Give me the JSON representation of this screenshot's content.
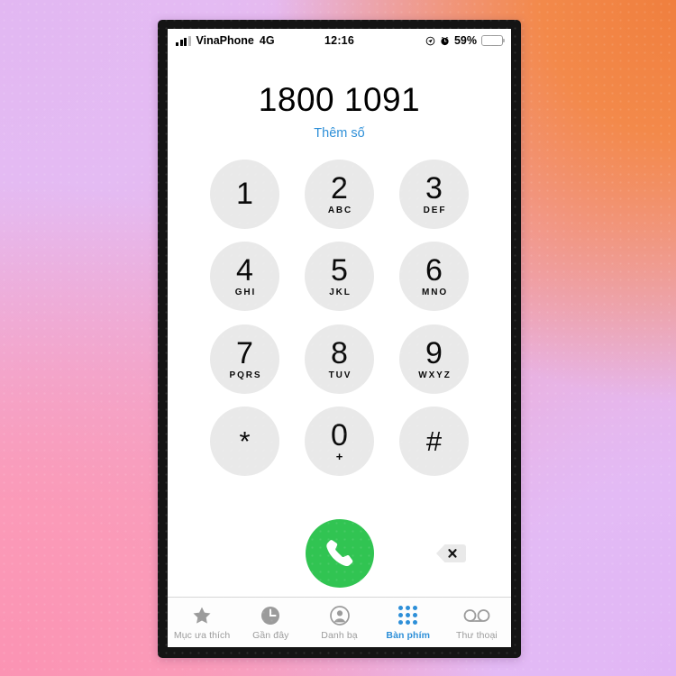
{
  "status_bar": {
    "carrier": "VinaPhone",
    "network": "4G",
    "time": "12:16",
    "battery_percent": "59%",
    "battery_level": 59,
    "icons": [
      "signal-bars-icon",
      "location-icon",
      "alarm-icon",
      "battery-icon"
    ]
  },
  "display": {
    "phone_number": "1800 1091",
    "add_number_label": "Thêm số"
  },
  "keypad": {
    "rows": [
      [
        {
          "digit": "1",
          "letters": ""
        },
        {
          "digit": "2",
          "letters": "ABC"
        },
        {
          "digit": "3",
          "letters": "DEF"
        }
      ],
      [
        {
          "digit": "4",
          "letters": "GHI"
        },
        {
          "digit": "5",
          "letters": "JKL"
        },
        {
          "digit": "6",
          "letters": "MNO"
        }
      ],
      [
        {
          "digit": "7",
          "letters": "PQRS"
        },
        {
          "digit": "8",
          "letters": "TUV"
        },
        {
          "digit": "9",
          "letters": "WXYZ"
        }
      ],
      [
        {
          "digit": "*",
          "letters": ""
        },
        {
          "digit": "0",
          "letters": "+"
        },
        {
          "digit": "#",
          "letters": ""
        }
      ]
    ]
  },
  "actions": {
    "call_icon": "phone-handset-icon",
    "delete_icon": "backspace-icon"
  },
  "tab_bar": {
    "active_index": 3,
    "tabs": [
      {
        "label": "Mục ưa thích",
        "icon": "star-icon"
      },
      {
        "label": "Gần đây",
        "icon": "clock-icon"
      },
      {
        "label": "Danh bạ",
        "icon": "person-circle-icon"
      },
      {
        "label": "Bàn phím",
        "icon": "keypad-dots-icon"
      },
      {
        "label": "Thư thoại",
        "icon": "voicemail-icon"
      }
    ]
  },
  "colors": {
    "accent_blue": "#2d8fd8",
    "call_green": "#31c452",
    "key_grey": "#e9e9e9",
    "battery_yellow": "#f7cf4a",
    "inactive_grey": "#9b9b9b"
  }
}
